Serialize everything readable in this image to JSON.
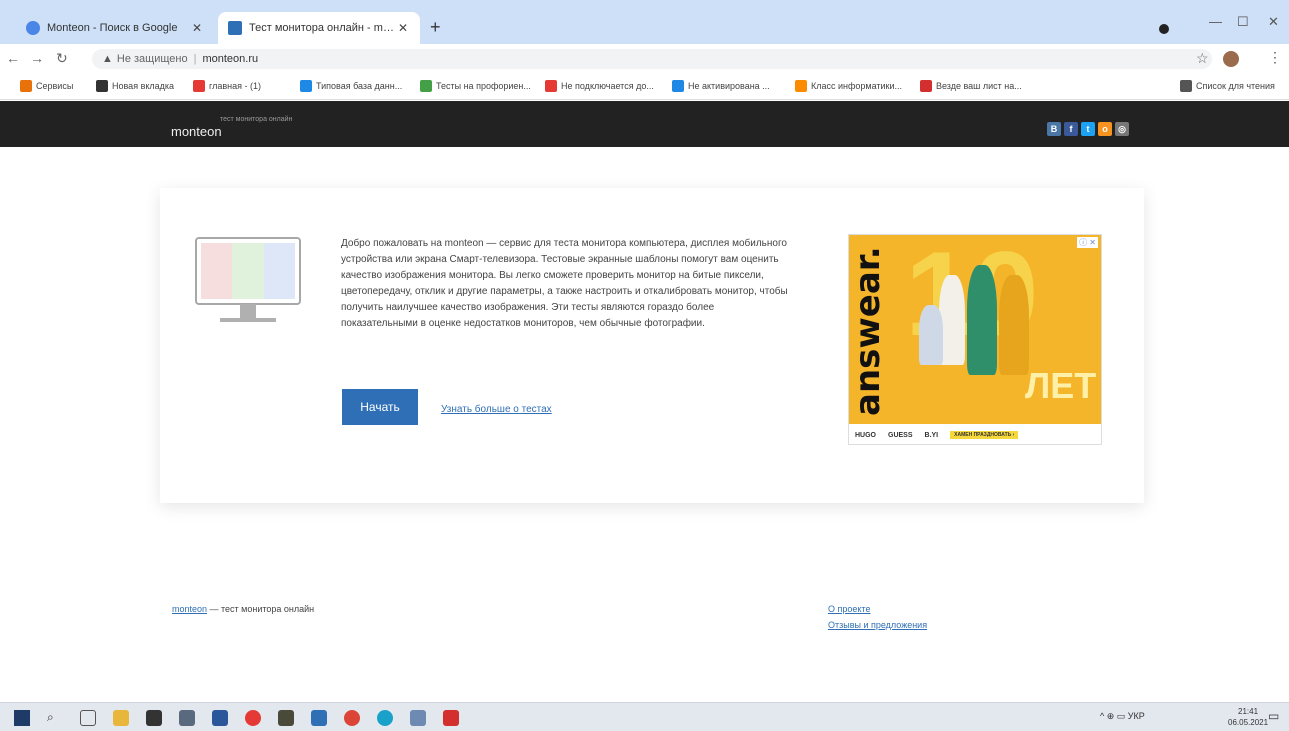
{
  "browser": {
    "tabs": [
      {
        "title": "Monteon - Поиск в Google",
        "color": "#4a86e8"
      },
      {
        "title": "Тест монитора онлайн - monte",
        "color": "#2f6fb6"
      }
    ],
    "new_tab_symbol": "+",
    "address": {
      "security_label": "Не защищено",
      "url": "monteon.ru"
    },
    "bookmarks": [
      {
        "label": "Сервисы",
        "color": "#e8710a"
      },
      {
        "label": "Новая вкладка",
        "color": "#333333"
      },
      {
        "label": "главная - (1)",
        "color": "#e53935"
      },
      {
        "label": "Типовая база данн...",
        "color": "#1e88e5"
      },
      {
        "label": "Тесты на профориен...",
        "color": "#43a047"
      },
      {
        "label": "Не подключается до...",
        "color": "#e53935"
      },
      {
        "label": "Не активирована ...",
        "color": "#1e88e5"
      },
      {
        "label": "Класс информатики...",
        "color": "#fb8c00"
      },
      {
        "label": "Везде ваш лист на...",
        "color": "#d32f2f"
      },
      {
        "label": "Список для чтения",
        "color": "#555555"
      }
    ]
  },
  "site": {
    "logo": "monteon",
    "tagline": "тест монитора онлайн",
    "social": [
      {
        "glyph": "В",
        "color": "#4a76a8",
        "name": "vk"
      },
      {
        "glyph": "f",
        "color": "#3b5998",
        "name": "facebook"
      },
      {
        "glyph": "t",
        "color": "#1da1f2",
        "name": "twitter"
      },
      {
        "glyph": "о",
        "color": "#f7931e",
        "name": "odnoklassniki"
      },
      {
        "glyph": "◎",
        "color": "#777777",
        "name": "other"
      }
    ],
    "intro_text": "Добро пожаловать на monteon — сервис для теста монитора компьютера, дисплея мобильного устройства или экрана Смарт-телевизора. Тестовые экранные шаблоны помогут вам оценить качество изображения монитора. Вы легко сможете проверить монитор на битые пиксели, цветопередачу, отклик и другие параметры, а также настроить и откалибровать монитор, чтобы получить наилучшее качество изображения. Эти тесты являются гораздо более показательными в оценке недостатков мониторов, чем обычные фотографии.",
    "start_button": "Начать",
    "more_link": "Узнать больше о тестах",
    "ad": {
      "brand": "answear.",
      "number": "10",
      "years": "ЛЕТ",
      "strip": [
        "HUGO",
        "GUESS",
        "B.YI"
      ],
      "cta": "ХАМЕН ПРАЗДНОВАТЬ ›",
      "close": "ⓘ ✕"
    },
    "footer": {
      "brand_link": "monteon",
      "brand_rest": " — тест монитора онлайн",
      "links": [
        "О проекте",
        "Отзывы и предложения"
      ]
    }
  },
  "taskbar": {
    "tray_text": "^ ⊕ ▭ УКР",
    "time": "21:41",
    "date": "06.05.2021"
  }
}
